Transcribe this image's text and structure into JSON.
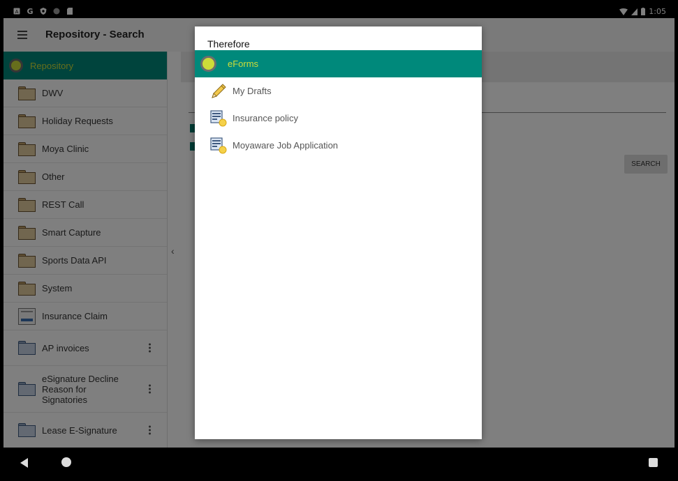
{
  "status_bar": {
    "time": "1:05",
    "left_icons": [
      "notification-a-icon",
      "google-icon",
      "shield-icon",
      "circle-icon",
      "sd-card-icon"
    ],
    "right_icons": [
      "wifi-icon",
      "signal-icon",
      "battery-icon"
    ]
  },
  "app_bar": {
    "title": "Repository - Search",
    "menu_icon": "hamburger-menu-icon"
  },
  "sidebar": {
    "header": {
      "label": "Repository",
      "icon": "eforms-dot-icon",
      "color": "#00897b"
    },
    "items": [
      {
        "label": "DWV",
        "icon": "folder-icon"
      },
      {
        "label": "Holiday Requests",
        "icon": "folder-icon"
      },
      {
        "label": "Moya Clinic",
        "icon": "folder-icon"
      },
      {
        "label": "Other",
        "icon": "folder-icon"
      },
      {
        "label": "REST Call",
        "icon": "folder-icon"
      },
      {
        "label": "Smart Capture",
        "icon": "folder-icon"
      },
      {
        "label": "Sports Data API",
        "icon": "folder-icon"
      },
      {
        "label": "System",
        "icon": "folder-icon"
      },
      {
        "label": "Insurance Claim",
        "icon": "document-category-icon"
      },
      {
        "label": "AP invoices",
        "icon": "blue-folder-icon",
        "more": true
      },
      {
        "label_lines": [
          "eSignature Decline",
          "Reason for",
          "Signatories"
        ],
        "icon": "blue-folder-icon",
        "more": true
      },
      {
        "label": "Lease E-Signature",
        "icon": "blue-folder-icon",
        "more": true
      }
    ]
  },
  "content": {
    "search_label": "SEARCH"
  },
  "dialog": {
    "title": "Therefore",
    "items": [
      {
        "label": "eForms",
        "icon": "eforms-dot-icon",
        "selected": true
      },
      {
        "label": "My Drafts",
        "icon": "pencil-icon"
      },
      {
        "label": "Insurance policy",
        "icon": "eform-document-icon"
      },
      {
        "label": "Moyaware Job Application",
        "icon": "eform-document-icon"
      }
    ],
    "selected_color": "#00897b",
    "selected_text_color": "#cddc39"
  },
  "nav_bar": {
    "icons": [
      "back-icon",
      "home-icon",
      "recents-icon"
    ]
  }
}
